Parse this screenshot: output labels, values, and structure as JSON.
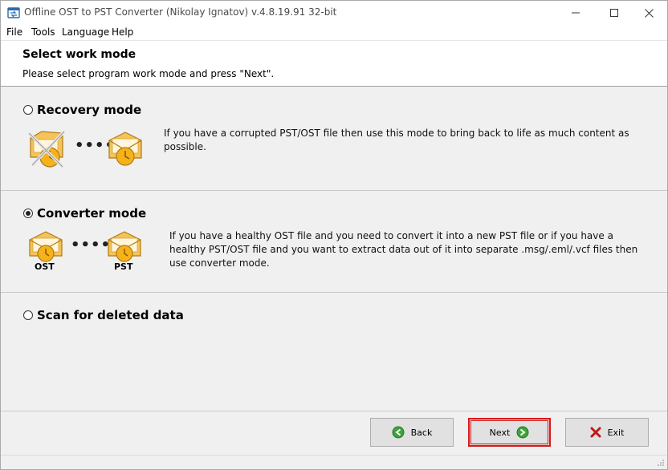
{
  "window": {
    "title": "Offline OST to PST Converter (Nikolay Ignatov) v.4.8.19.91 32-bit",
    "app_icon": "converter-app-icon",
    "controls": {
      "minimize": "minimize-icon",
      "maximize": "maximize-icon",
      "close": "close-icon"
    }
  },
  "menu": {
    "items": [
      {
        "label": "File"
      },
      {
        "label": "Tools"
      },
      {
        "label": "Language"
      },
      {
        "label": "Help"
      }
    ]
  },
  "header": {
    "title": "Select work mode",
    "subtitle": "Please select program work mode and press \"Next\"."
  },
  "modes": {
    "recovery": {
      "label": "Recovery mode",
      "selected": false,
      "description": "If you have a corrupted PST/OST file then use this mode to bring back to life as much content as possible.",
      "dots": "••••"
    },
    "converter": {
      "label": "Converter mode",
      "selected": true,
      "description": "If you have a healthy OST file and you need to convert it into a new PST file or if you have a healthy PST/OST file and you want to extract data out of it into separate .msg/.eml/.vcf files then use converter mode.",
      "dots": "••••",
      "source_caption": "OST",
      "target_caption": "PST"
    },
    "scan": {
      "label": "Scan for deleted data",
      "selected": false
    }
  },
  "buttons": {
    "back": {
      "label": "Back",
      "icon": "arrow-left-circle-icon",
      "color": "#3aa53a"
    },
    "next": {
      "label": "Next",
      "icon": "arrow-right-circle-icon",
      "color": "#3aa53a",
      "highlight": "#d61a1a"
    },
    "exit": {
      "label": "Exit",
      "icon": "red-x-icon",
      "color": "#c01818"
    }
  }
}
